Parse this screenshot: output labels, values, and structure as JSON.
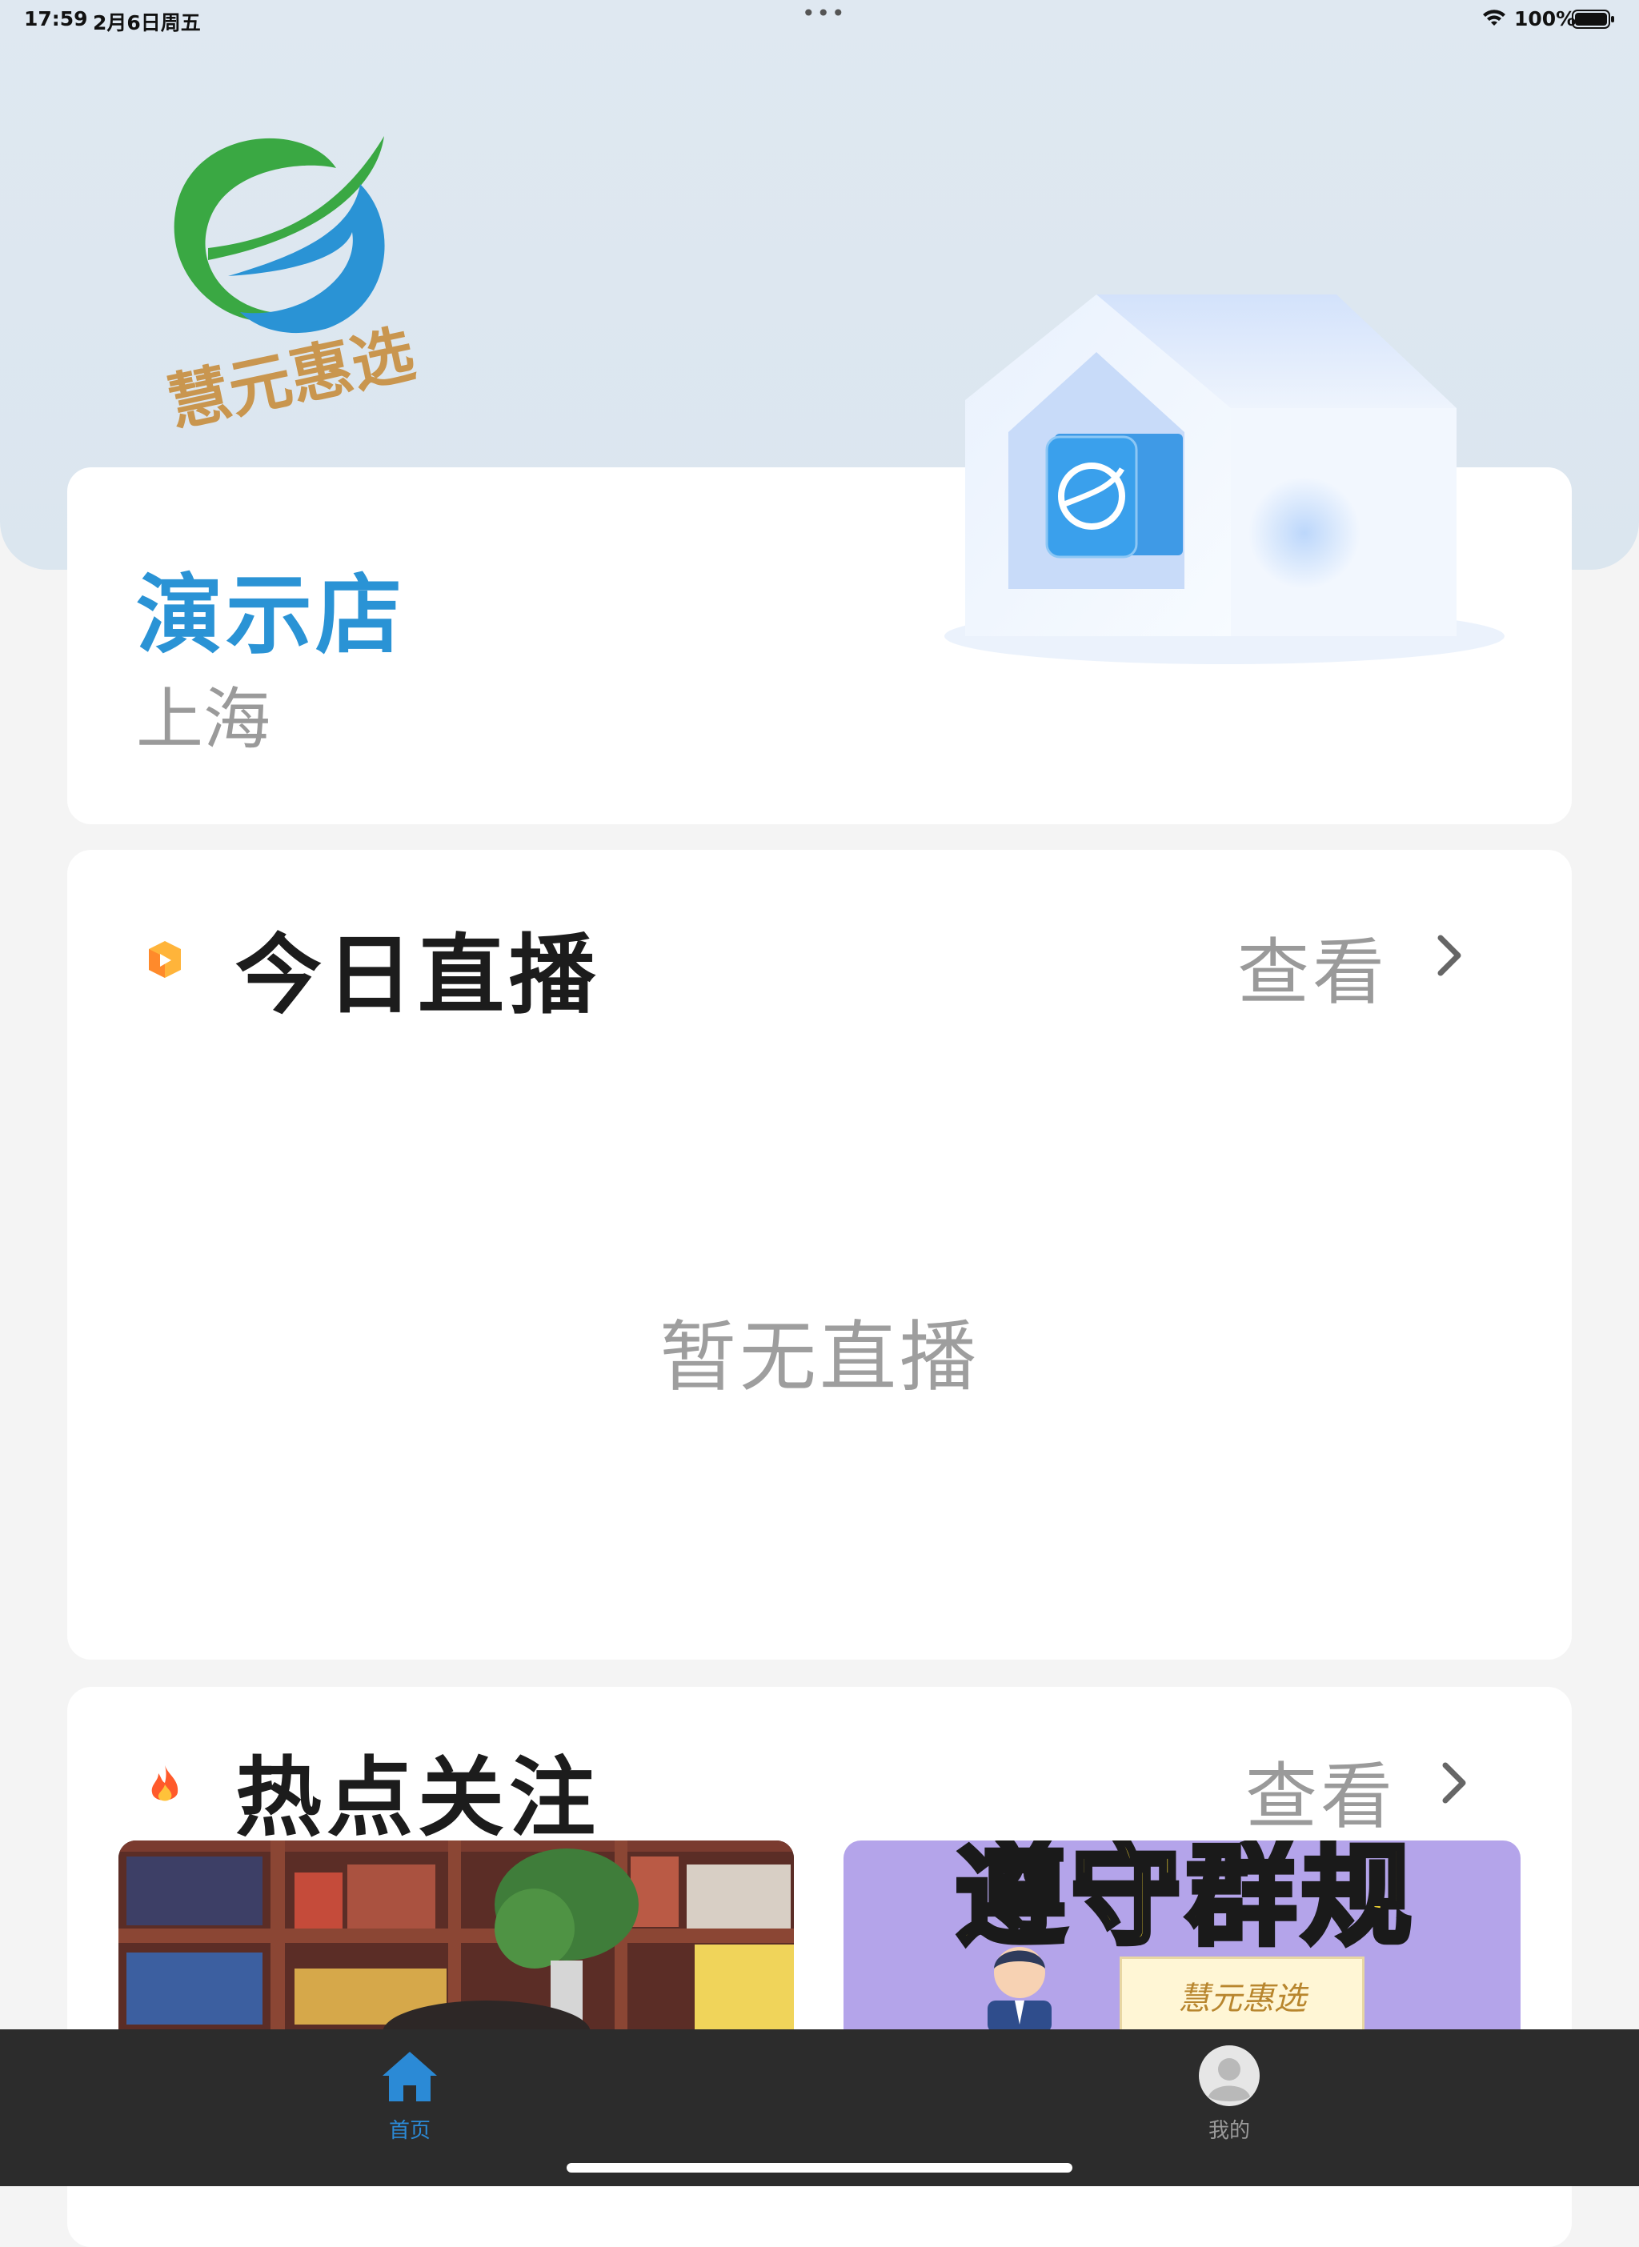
{
  "status_bar": {
    "time": "17:59",
    "date": "2月6日周五",
    "battery": "100%"
  },
  "brand": {
    "logo_text": "慧元惠选",
    "logo_colors": [
      "#3aa843",
      "#2a93d5",
      "#c9964f"
    ]
  },
  "store": {
    "name": "演示店",
    "city": "上海"
  },
  "live_section": {
    "title": "今日直播",
    "more_label": "查看",
    "empty_text": "暂无直播",
    "icon": "live-video-icon"
  },
  "hot_section": {
    "title": "热点关注",
    "more_label": "查看",
    "icon": "fire-icon",
    "items": [
      {
        "thumb_text": ""
      },
      {
        "thumb_text": "遵守群规",
        "brand_text": "慧元惠选"
      }
    ]
  },
  "tabbar": {
    "tabs": [
      {
        "label": "首页",
        "icon": "home-icon",
        "active": true
      },
      {
        "label": "我的",
        "icon": "user-icon",
        "active": false
      }
    ],
    "active_color": "#2b8ad6",
    "inactive_color": "#9a9a9a"
  }
}
